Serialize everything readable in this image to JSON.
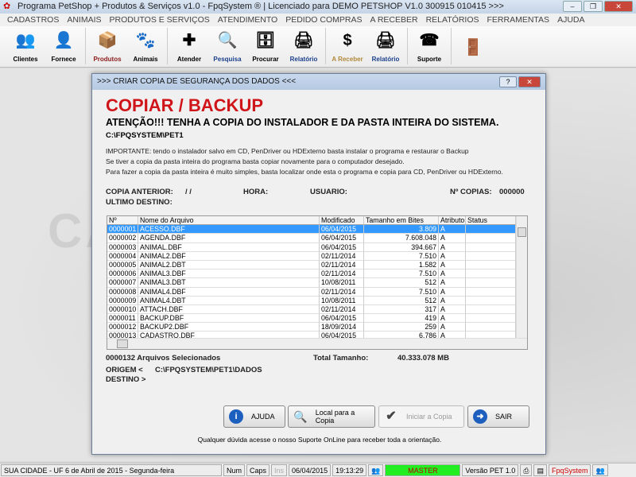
{
  "window": {
    "title": "Programa PetShop + Produtos & Serviços v1.0 - FpqSystem ® | Licenciado para  DEMO PETSHOP V1.0 300915 010415 >>>"
  },
  "menu": [
    "CADASTROS",
    "ANIMAIS",
    "PRODUTOS E SERVIÇOS",
    "ATENDIMENTO",
    "PEDIDO COMPRAS",
    "A RECEBER",
    "RELATÓRIOS",
    "FERRAMENTAS",
    "AJUDA"
  ],
  "toolbar": [
    {
      "label": "Clientes",
      "icon": "users-icon",
      "color": "#000"
    },
    {
      "label": "Fornece",
      "icon": "person-icon",
      "color": "#000"
    },
    {
      "label": "Produtos",
      "icon": "boxes-icon",
      "color": "#8b1a1a"
    },
    {
      "label": "Animais",
      "icon": "paw-icon",
      "color": "#000"
    },
    {
      "label": "Atender",
      "icon": "paw-plus-icon",
      "color": "#000"
    },
    {
      "label": "Pesquisa",
      "icon": "search-docs-icon",
      "color": "#1a3f8b"
    },
    {
      "label": "Procurar",
      "icon": "drawer-icon",
      "color": "#000"
    },
    {
      "label": "Relatório",
      "icon": "printer-icon",
      "color": "#1a3f8b"
    },
    {
      "label": "A Receber",
      "icon": "money-icon",
      "color": "#b08a3a"
    },
    {
      "label": "Relatório",
      "icon": "printer-icon",
      "color": "#1a3f8b"
    },
    {
      "label": "Suporte",
      "icon": "support-icon",
      "color": "#000"
    },
    {
      "label": "",
      "icon": "exit-door-icon",
      "color": "#000"
    }
  ],
  "watermark": "CA",
  "dialog": {
    "title": ">>> CRIAR COPIA DE SEGURANÇA DOS DADOS <<<",
    "heading": "COPIAR / BACKUP",
    "attention": "ATENÇÃO!!!  TENHA A COPIA DO  INSTALADOR  E  DA PASTA INTEIRA DO  SISTEMA.",
    "path": "C:\\FPQSYSTEM\\PET1",
    "info": [
      "IMPORTANTE: tendo o instalador salvo em CD, PenDriver ou HDExterno basta instalar o programa e restaurar o Backup",
      "Se tiver a copia da pasta inteira do programa basta copiar novamente para o computador desejado.",
      "Para fazer a copia da pasta inteira é muito simples, basta localizar onde esta o programa e copia para CD, PenDriver ou HDExterno."
    ],
    "copia_anterior_label": "COPIA ANTERIOR:",
    "copia_anterior_value": "/  /",
    "hora_label": "HORA:",
    "usuario_label": "USUARIO:",
    "num_copias_label": "Nº COPIAS:",
    "num_copias_value": "000000",
    "ultimo_destino_label": "ULTIMO DESTINO:",
    "columns": [
      "Nº",
      "Nome do Arquivo",
      "Modificado",
      "Tamanho em Bites",
      "Atributo",
      "Status"
    ],
    "rows": [
      [
        "0000001",
        "ACESSO.DBF",
        "06/04/2015",
        "3.809",
        "A",
        ""
      ],
      [
        "0000002",
        "AGENDA.DBF",
        "06/04/2015",
        "7.608.048",
        "A",
        ""
      ],
      [
        "0000003",
        "ANIMAL.DBF",
        "06/04/2015",
        "394.667",
        "A",
        ""
      ],
      [
        "0000004",
        "ANIMAL2.DBF",
        "02/11/2014",
        "7.510",
        "A",
        ""
      ],
      [
        "0000005",
        "ANIMAL2.DBT",
        "02/11/2014",
        "1.582",
        "A",
        ""
      ],
      [
        "0000006",
        "ANIMAL3.DBF",
        "02/11/2014",
        "7.510",
        "A",
        ""
      ],
      [
        "0000007",
        "ANIMAL3.DBT",
        "10/08/2011",
        "512",
        "A",
        ""
      ],
      [
        "0000008",
        "ANIMAL4.DBF",
        "02/11/2014",
        "7.510",
        "A",
        ""
      ],
      [
        "0000009",
        "ANIMAL4.DBT",
        "10/08/2011",
        "512",
        "A",
        ""
      ],
      [
        "0000010",
        "ATTACH.DBF",
        "02/11/2014",
        "317",
        "A",
        ""
      ],
      [
        "0000011",
        "BACKUP.DBF",
        "06/04/2015",
        "419",
        "A",
        ""
      ],
      [
        "0000012",
        "BACKUP2.DBF",
        "18/09/2014",
        "259",
        "A",
        ""
      ],
      [
        "0000013",
        "CADASTRO.DBF",
        "06/04/2015",
        "6.786",
        "A",
        ""
      ]
    ],
    "selected_count": "0000132 Arquivos  Selecionados",
    "total_label": "Total Tamanho:",
    "total_value": "40.333.078 MB",
    "origem_label": "ORIGEM  <",
    "origem_value": "C:\\FPQSYSTEM\\PET1\\DADOS",
    "destino_label": "DESTINO >",
    "buttons": {
      "ajuda": "AJUDA",
      "local": "Local para a Copia",
      "iniciar": "Iniciar a Copia",
      "sair": "SAIR"
    },
    "help_text": "Qualquer dúvida acesse o nosso Suporte OnLine para receber toda a orientação."
  },
  "status": {
    "city": "SUA CIDADE - UF  6 de Abril de 2015 - Segunda-feira",
    "num": "Num",
    "caps": "Caps",
    "ins": "Ins",
    "date": "06/04/2015",
    "time": "19:13:29",
    "user": "MASTER",
    "version": "Versão PET 1.0",
    "brand": "FpqSystem"
  },
  "colors": {
    "accent_red": "#d0151a",
    "selection": "#3399ff",
    "master_bg": "#22ee22"
  }
}
